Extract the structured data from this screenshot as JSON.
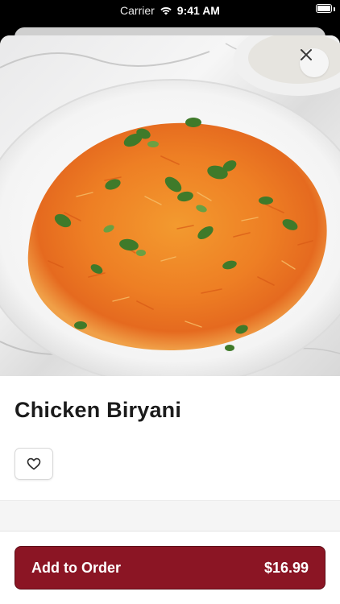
{
  "status_bar": {
    "carrier": "Carrier",
    "time": "9:41 AM"
  },
  "item": {
    "name": "Chicken Biryani",
    "image_subject": "plate of chicken biryani"
  },
  "actions": {
    "close_icon": "close-icon",
    "favorite_icon": "heart-outline-icon",
    "add_label": "Add to Order",
    "price": "$16.99"
  },
  "colors": {
    "accent": "#8b1524",
    "accent_border": "#5e0c17"
  }
}
